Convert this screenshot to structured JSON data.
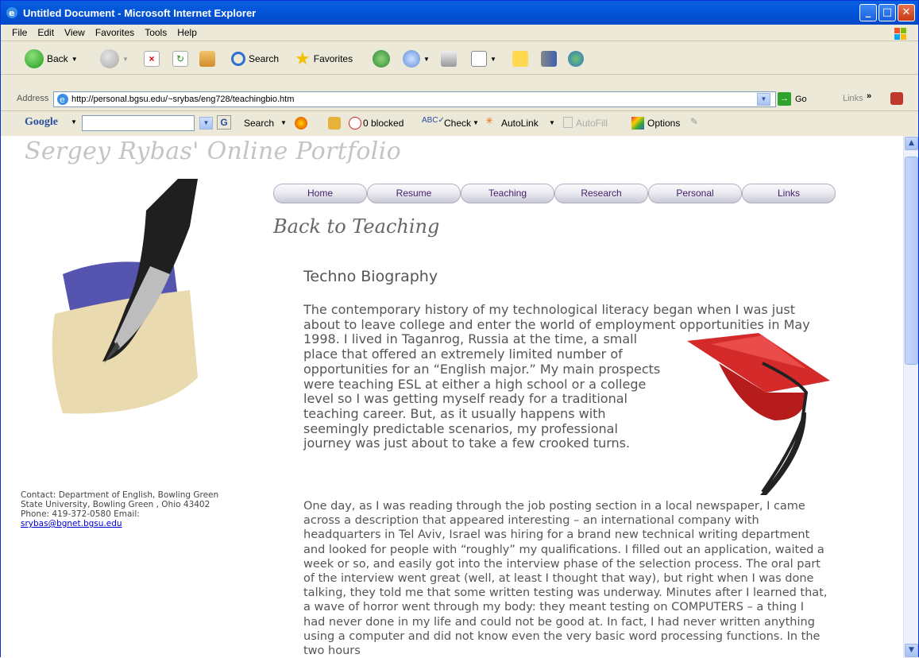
{
  "window": {
    "title": "Untitled Document - Microsoft Internet Explorer",
    "controls": [
      "_",
      "□",
      "✕"
    ]
  },
  "menu": [
    "File",
    "Edit",
    "View",
    "Favorites",
    "Tools",
    "Help"
  ],
  "toolbar": {
    "back_label": "Back",
    "search_label": "Search",
    "favorites_label": "Favorites"
  },
  "address": {
    "label": "Address",
    "url": "http://personal.bgsu.edu/~srybas/eng728/teachingbio.htm",
    "go_label": "Go",
    "links_label": "Links"
  },
  "google_bar": {
    "brand": "Google",
    "search_label": "Search",
    "blocked_label": "0 blocked",
    "check_label": "Check",
    "autolink_label": "AutoLink",
    "autofill_label": "AutoFill",
    "options_label": "Options"
  },
  "page": {
    "site_title": "Sergey Rybas' Online Portfolio",
    "nav": [
      "Home",
      "Resume",
      "Teaching",
      "Research",
      "Personal",
      "Links"
    ],
    "back_link": "Back to Teaching",
    "section_title": "Techno Biography",
    "paragraph1": "The contemporary history of my technological literacy began when I was just about to leave college and enter the world of employment opportunities in May 1998. I lived in Taganrog, Russia at the time, a small place that offered an extremely limited number of opportunities for an “English major.” My main prospects were teaching ESL at either a high school or a college level so I was getting myself ready for a traditional teaching career. But, as it usually happens with seemingly predictable scenarios, my professional journey was just about to take a few crooked turns.",
    "paragraph2": "One day, as I was reading through the job posting section in a local newspaper, I came across a description that appeared interesting – an international company with headquarters in Tel Aviv, Israel was hiring for a brand new technical writing department and looked for people with “roughly” my qualifications. I filled out an application, waited a week or so, and easily got into the interview phase of the selection process. The oral part of the interview went great (well, at least I thought that way), but right when I was done talking, they told me that some written testing was underway. Minutes after I learned that, a wave of horror went through my body: they meant testing on COMPUTERS – a thing I had never done in my life and could not be good at. In fact, I had never written anything using a computer and did not know even the very basic word processing functions. In the two hours",
    "contact_text": "Contact: Department of English, Bowling Green State University, Bowling Green , Ohio 43402 Phone: 419-372-0580 Email:",
    "contact_email": "srybas@bgnet.bgsu.edu"
  },
  "colors": {
    "titlebar": "#0356d8",
    "nav_text": "#46206a",
    "body_text": "#555555",
    "cap_red": "#d42a2a"
  }
}
